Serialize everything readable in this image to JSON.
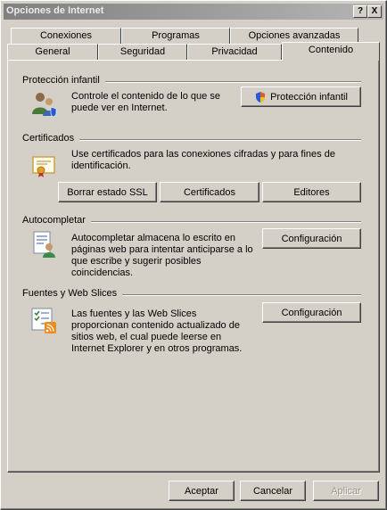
{
  "window": {
    "title": "Opciones de Internet",
    "help_label": "?",
    "close_label": "X"
  },
  "tabs": {
    "row1": [
      {
        "label": "Conexiones"
      },
      {
        "label": "Programas"
      },
      {
        "label": "Opciones avanzadas"
      }
    ],
    "row2": [
      {
        "label": "General"
      },
      {
        "label": "Seguridad"
      },
      {
        "label": "Privacidad"
      },
      {
        "label": "Contenido",
        "active": true
      }
    ]
  },
  "sections": {
    "parental": {
      "title": "Protección infantil",
      "description": "Controle el contenido de lo que se puede ver en Internet.",
      "button": "Protección infantil"
    },
    "certificates": {
      "title": "Certificados",
      "description": "Use certificados para las conexiones cifradas y para fines de identificación.",
      "buttons": [
        "Borrar estado SSL",
        "Certificados",
        "Editores"
      ]
    },
    "autocomplete": {
      "title": "Autocompletar",
      "description": "Autocompletar almacena lo escrito en páginas web para intentar anticiparse a lo que escribe y sugerir posibles coincidencias.",
      "button": "Configuración"
    },
    "feeds": {
      "title": "Fuentes y Web Slices",
      "description": "Las fuentes y las Web Slices proporcionan contenido actualizado de sitios web, el cual puede leerse en Internet Explorer y en otros programas.",
      "button": "Configuración"
    }
  },
  "footer": {
    "accept": "Aceptar",
    "cancel": "Cancelar",
    "apply": "Aplicar"
  },
  "colors": {
    "face": "#d4d0c8",
    "title_inactive": "#808080",
    "disabled_text": "#9a9790"
  }
}
